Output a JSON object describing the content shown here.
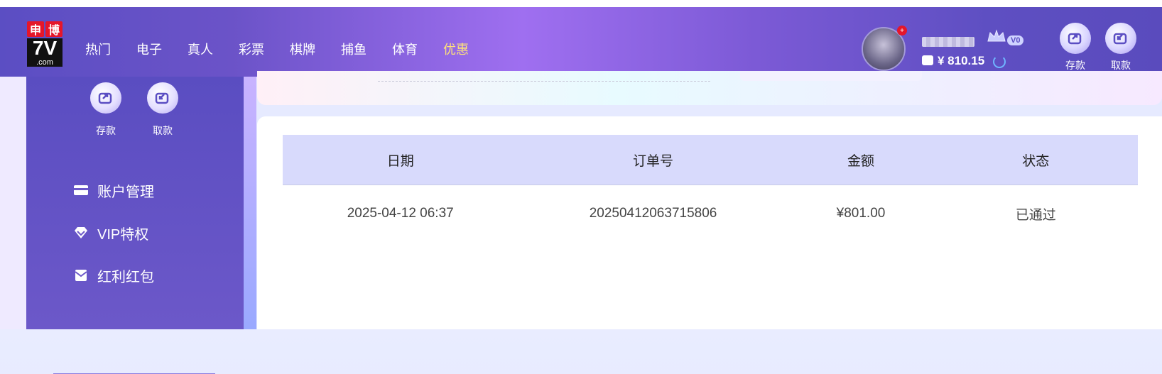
{
  "logo": {
    "top_left": "申",
    "top_right": "博",
    "main": "7V",
    "sub": ".com"
  },
  "nav": [
    {
      "label": "热门"
    },
    {
      "label": "电子"
    },
    {
      "label": "真人"
    },
    {
      "label": "彩票"
    },
    {
      "label": "棋牌"
    },
    {
      "label": "捕鱼"
    },
    {
      "label": "体育"
    },
    {
      "label": "优惠"
    }
  ],
  "user": {
    "vip_level": "V0",
    "balance": "¥ 810.15",
    "avatar_badge": "+"
  },
  "top_actions": {
    "deposit": "存款",
    "withdraw": "取款"
  },
  "sidebar": {
    "deposit": "存款",
    "withdraw": "取款",
    "menu": [
      {
        "label": "账户管理",
        "icon": "card-icon"
      },
      {
        "label": "VIP特权",
        "icon": "vip-diamond-icon"
      },
      {
        "label": "红利红包",
        "icon": "red-envelope-icon"
      }
    ]
  },
  "table": {
    "headers": {
      "date": "日期",
      "order": "订单号",
      "amount": "金额",
      "status": "状态"
    },
    "rows": [
      {
        "date": "2025-04-12 06:37",
        "order": "20250412063715806",
        "amount": "¥801.00",
        "status": "已通过"
      }
    ]
  },
  "colors": {
    "accent": "#5b4ec3",
    "highlight_nav": "#ffe27a",
    "table_header": "#d8dafc"
  }
}
